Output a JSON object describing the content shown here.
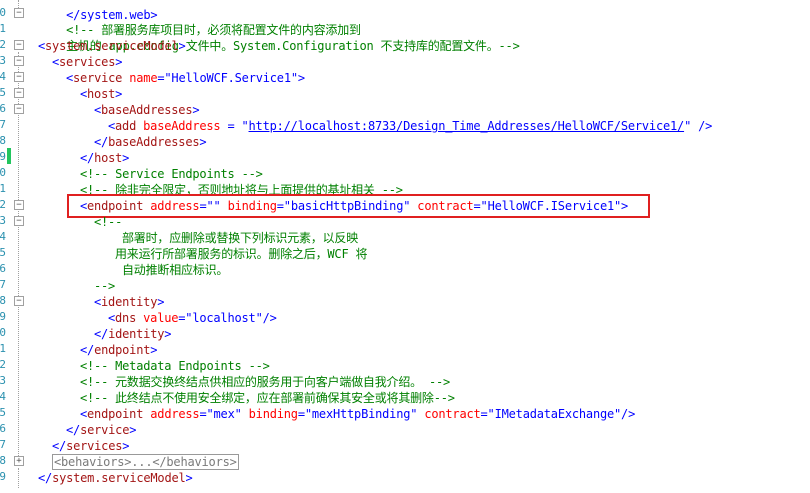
{
  "editor": {
    "line_numbers": [
      "0",
      "1",
      "2",
      "3",
      "4",
      "5",
      "6",
      "7",
      "8",
      "9",
      "0",
      "1",
      "2",
      "3",
      "4",
      "5",
      "6",
      "7",
      "8",
      "9",
      "0",
      "1",
      "2",
      "3",
      "4",
      "5",
      "6",
      "7",
      "8",
      "9"
    ],
    "top_partial": "</system.web>",
    "comment1_line1": "<!-- 部署服务库项目时，必须将配置文件的内容添加到",
    "comment1_line2": "主机的 app.config 文件中。System.Configuration 不支持库的配置文件。-->",
    "sm_open": "system.serviceModel",
    "services": "services",
    "service_tag": "service",
    "name_attr": "name",
    "service_name": "HelloWCF.Service1",
    "host": "host",
    "baseAddresses": "baseAddresses",
    "add": "add",
    "baseAddress_attr": "baseAddress",
    "base_url": "http://localhost:8733/Design_Time_Addresses/HelloWCF/Service1/",
    "comment_service_endpoints": "<!-- Service Endpoints -->",
    "comment_unless_qualified": "<!-- 除非完全限定，否则地址将与上面提供的基址相关 -->",
    "endpoint": "endpoint",
    "address_attr": "address",
    "empty_val": "",
    "binding_attr": "binding",
    "binding_val": "basicHttpBinding",
    "contract_attr": "contract",
    "contract_val": "HelloWCF.IService1",
    "comment_open": "<!--",
    "deploy_note1": "部署时，应删除或替换下列标识元素，以反映",
    "deploy_note2": "用来运行所部署服务的标识。删除之后，WCF 将",
    "deploy_note3": "自动推断相应标识。",
    "comment_close": "-->",
    "identity": "identity",
    "dns": "dns",
    "value_attr": "value",
    "dns_val": "localhost",
    "comment_metadata": "<!-- Metadata Endpoints -->",
    "comment_metadata_desc": "<!-- 元数据交换终结点供相应的服务用于向客户端做自我介绍。 -->",
    "comment_security": "<!-- 此终结点不使用安全绑定，应在部署前确保其安全或将其删除-->",
    "mex_val": "mex",
    "mex_binding_val": "mexHttpBinding",
    "mex_contract_val": "IMetadataExchange",
    "behaviors_collapsed": "<behaviors>...</behaviors>",
    "fold_minus": "−",
    "fold_plus": "+",
    "colors": {
      "highlight_box": "#e02020",
      "change_bar": "#22c55e",
      "comment": "#008000",
      "tag": "#a31515",
      "attr": "#ff0000",
      "value": "#0000ff"
    }
  }
}
